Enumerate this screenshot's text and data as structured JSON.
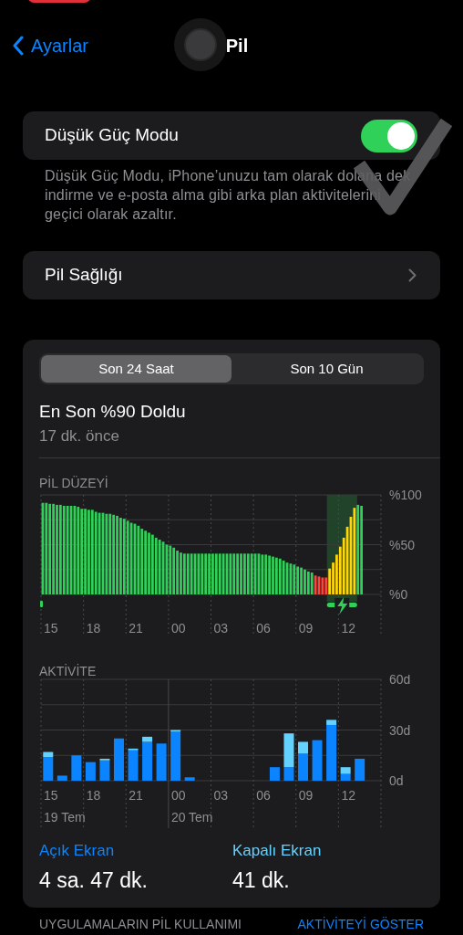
{
  "nav": {
    "back_label": "Ayarlar",
    "title": "Pil"
  },
  "low_power": {
    "label": "Düşük Güç Modu",
    "on": true,
    "description": "Düşük Güç Modu, iPhone’unuzu tam olarak dolana dek indirme ve e-posta alma gibi arka plan aktivitelerini geçici olarak azaltır."
  },
  "battery_health": {
    "label": "Pil Sağlığı"
  },
  "usage": {
    "segments": [
      {
        "label": "Son 24 Saat",
        "selected": true
      },
      {
        "label": "Son 10 Gün",
        "selected": false
      }
    ],
    "last_charge": {
      "title": "En Son %90 Doldu",
      "subtitle": "17 dk. önce"
    },
    "battery_level": {
      "label": "PİL DÜZEYİ",
      "hour_labels": [
        {
          "text": "15"
        },
        {
          "text": "18"
        },
        {
          "text": "21"
        },
        {
          "text": "00"
        },
        {
          "text": "03"
        },
        {
          "text": "06"
        },
        {
          "text": "09"
        },
        {
          "text": "12"
        }
      ],
      "chart_data": {
        "type": "bar",
        "grid": true,
        "ylim": [
          0,
          100
        ],
        "yticks": [
          {
            "value": 0,
            "label": "%0"
          },
          {
            "value": 50,
            "label": "%50"
          },
          {
            "value": 100,
            "label": "%100"
          }
        ],
        "series": [
          {
            "color": "#30d158",
            "values": [
              92,
              92,
              91,
              91,
              90,
              90,
              89,
              89,
              89,
              89,
              88,
              86,
              86,
              85,
              85,
              83,
              82,
              82,
              81,
              81,
              80,
              79,
              77,
              76,
              74,
              72,
              71,
              69,
              66,
              64,
              62,
              60,
              57,
              55,
              53,
              50,
              49,
              47,
              44,
              42,
              41,
              41,
              41,
              41,
              41,
              41,
              41,
              41,
              41,
              41,
              41,
              41,
              41,
              41,
              41,
              41,
              41,
              41,
              41,
              41,
              41,
              41,
              40,
              40,
              39,
              38,
              37,
              36,
              34,
              32,
              31,
              30,
              28,
              27,
              25,
              23,
              22,
              null,
              null,
              null,
              null,
              null,
              null,
              null,
              null,
              null,
              null,
              null,
              null,
              90,
              89,
              null,
              null,
              null,
              null,
              null
            ]
          },
          {
            "color": "#ff453a",
            "values": [
              null,
              null,
              null,
              null,
              null,
              null,
              null,
              null,
              null,
              null,
              null,
              null,
              null,
              null,
              null,
              null,
              null,
              null,
              null,
              null,
              null,
              null,
              null,
              null,
              null,
              null,
              null,
              null,
              null,
              null,
              null,
              null,
              null,
              null,
              null,
              null,
              null,
              null,
              null,
              null,
              null,
              null,
              null,
              null,
              null,
              null,
              null,
              null,
              null,
              null,
              null,
              null,
              null,
              null,
              null,
              null,
              null,
              null,
              null,
              null,
              null,
              null,
              null,
              null,
              null,
              null,
              null,
              null,
              null,
              null,
              null,
              null,
              null,
              null,
              null,
              null,
              null,
              19,
              18,
              17,
              17,
              null,
              null,
              null,
              null,
              null,
              null,
              null,
              null,
              null,
              null,
              null,
              null,
              null,
              null,
              null
            ]
          },
          {
            "color": "#ffd60a",
            "values": [
              null,
              null,
              null,
              null,
              null,
              null,
              null,
              null,
              null,
              null,
              null,
              null,
              null,
              null,
              null,
              null,
              null,
              null,
              null,
              null,
              null,
              null,
              null,
              null,
              null,
              null,
              null,
              null,
              null,
              null,
              null,
              null,
              null,
              null,
              null,
              null,
              null,
              null,
              null,
              null,
              null,
              null,
              null,
              null,
              null,
              null,
              null,
              null,
              null,
              null,
              null,
              null,
              null,
              null,
              null,
              null,
              null,
              null,
              null,
              null,
              null,
              null,
              null,
              null,
              null,
              null,
              null,
              null,
              null,
              null,
              null,
              null,
              null,
              null,
              null,
              null,
              null,
              null,
              null,
              null,
              null,
              26,
              32,
              40,
              48,
              57,
              68,
              78,
              87,
              null,
              null,
              null,
              null,
              null,
              null,
              null
            ]
          }
        ]
      }
    },
    "activity": {
      "label": "AKTİVİTE",
      "hour_labels": [
        {
          "text": "15",
          "date": "19 Tem"
        },
        {
          "text": "18"
        },
        {
          "text": "21"
        },
        {
          "text": "00",
          "date": "20 Tem"
        },
        {
          "text": "03"
        },
        {
          "text": "06"
        },
        {
          "text": "09"
        },
        {
          "text": "12"
        }
      ],
      "chart_data": {
        "type": "bar",
        "stacked": true,
        "grid": true,
        "ylim": [
          0,
          60
        ],
        "yticks": [
          {
            "value": 0,
            "label": "0d"
          },
          {
            "value": 30,
            "label": "30d"
          },
          {
            "value": 60,
            "label": "60d"
          }
        ],
        "series": [
          {
            "name": "Açık Ekran",
            "color": "#0a84ff",
            "values": [
              14,
              3,
              15,
              11,
              12,
              25,
              18,
              23,
              22,
              29,
              2,
              null,
              null,
              null,
              null,
              null,
              8,
              8,
              16,
              24,
              33,
              4,
              13,
              null
            ]
          },
          {
            "name": "Kapalı Ekran",
            "color": "#64d2ff",
            "values": [
              3,
              null,
              null,
              null,
              1,
              null,
              1,
              3,
              null,
              1,
              null,
              null,
              null,
              null,
              null,
              null,
              null,
              20,
              7,
              null,
              3,
              4,
              null,
              null
            ]
          }
        ]
      }
    },
    "screen_on": {
      "value": "4 sa. 47 dk."
    },
    "screen_off": {
      "value": "41 dk."
    }
  },
  "app_usage": {
    "title": "UYGULAMALARIN PİL KULLANIMI",
    "action": "AKTİVİTEYİ GÖSTER"
  }
}
